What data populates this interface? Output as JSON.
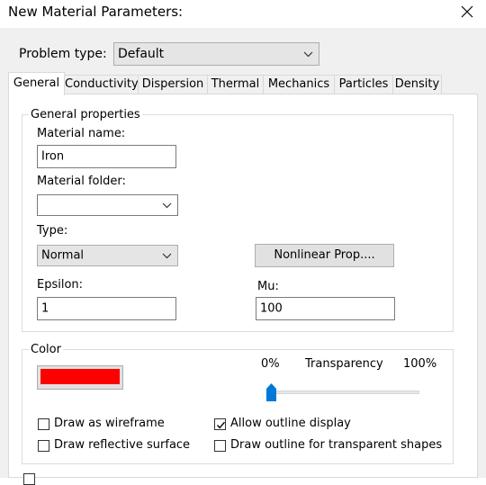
{
  "window": {
    "title": "New Material Parameters:"
  },
  "problem_type": {
    "label": "Problem type:",
    "value": "Default"
  },
  "tabs": [
    {
      "label": "General"
    },
    {
      "label": "Conductivity"
    },
    {
      "label": "Dispersion"
    },
    {
      "label": "Thermal"
    },
    {
      "label": "Mechanics"
    },
    {
      "label": "Particles"
    },
    {
      "label": "Density"
    }
  ],
  "general_properties": {
    "title": "General properties",
    "material_name_label": "Material name:",
    "material_name_value": "Iron",
    "material_folder_label": "Material folder:",
    "material_folder_value": "",
    "type_label": "Type:",
    "type_value": "Normal",
    "nonlinear_button": "Nonlinear Prop....",
    "epsilon_label": "Epsilon:",
    "epsilon_value": "1",
    "mu_label": "Mu:",
    "mu_value": "100"
  },
  "color_group": {
    "title": "Color",
    "swatch_color": "#ff0000",
    "transparency_min": "0%",
    "transparency_label": "Transparency",
    "transparency_max": "100%",
    "transparency_value": 0,
    "checkboxes": [
      {
        "label": "Draw as wireframe",
        "checked": false
      },
      {
        "label": "Allow outline display",
        "checked": true
      },
      {
        "label": "Draw reflective surface",
        "checked": false
      },
      {
        "label": "Draw outline for transparent shapes",
        "checked": false
      }
    ]
  }
}
